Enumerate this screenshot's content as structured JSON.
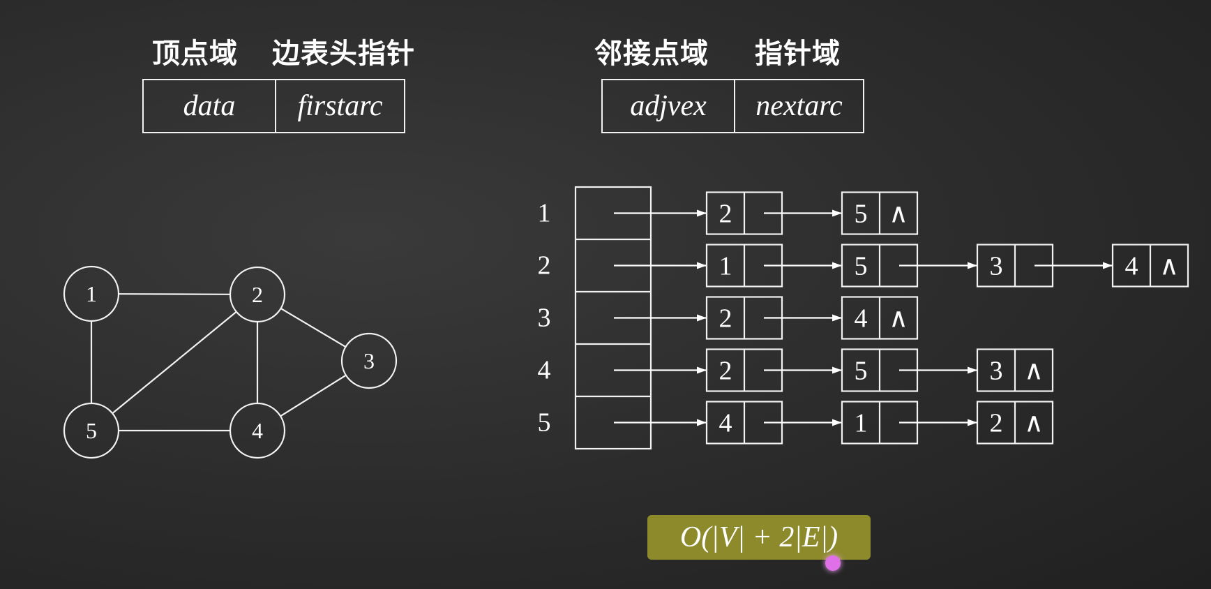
{
  "headings": {
    "vertex_field": "顶点域",
    "edge_head_pointer": "边表头指针",
    "adjacent_field": "邻接点域",
    "pointer_field": "指针域"
  },
  "vertex_node_struct": [
    "data",
    "firstarc"
  ],
  "arc_node_struct": [
    "adjvex",
    "nextarc"
  ],
  "graph": {
    "vertices": [
      "1",
      "2",
      "3",
      "4",
      "5"
    ],
    "edges": [
      [
        "1",
        "2"
      ],
      [
        "1",
        "5"
      ],
      [
        "2",
        "5"
      ],
      [
        "2",
        "4"
      ],
      [
        "2",
        "3"
      ],
      [
        "3",
        "4"
      ],
      [
        "4",
        "5"
      ]
    ]
  },
  "adjacency_list": {
    "row_labels": [
      "1",
      "2",
      "3",
      "4",
      "5"
    ],
    "rows": [
      [
        "2",
        "5"
      ],
      [
        "1",
        "5",
        "3",
        "4"
      ],
      [
        "2",
        "4"
      ],
      [
        "2",
        "5",
        "3"
      ],
      [
        "4",
        "1",
        "2"
      ]
    ],
    "null_symbol": "∧"
  },
  "complexity": "O(|V| + 2|E|)"
}
